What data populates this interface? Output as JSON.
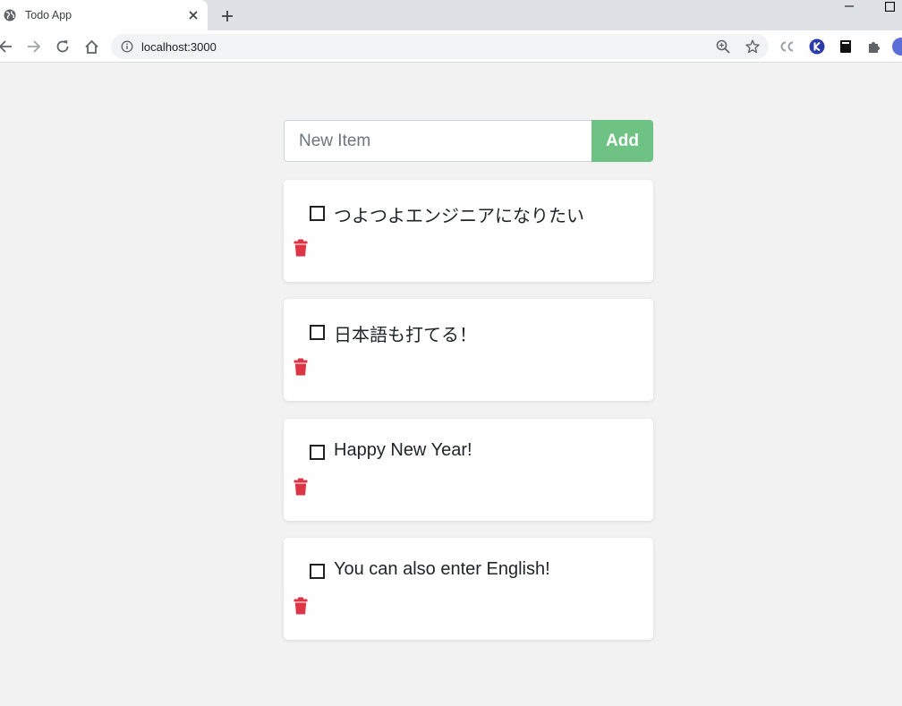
{
  "browser": {
    "tab_title": "Todo App",
    "url": "localhost:3000"
  },
  "app": {
    "input_placeholder": "New Item",
    "add_label": "Add",
    "accent_color": "#6ec283",
    "delete_color": "#dc3545",
    "items": [
      {
        "text": "つよつよエンジニアになりたい",
        "completed": false
      },
      {
        "text": "日本語も打てる！",
        "completed": false
      },
      {
        "text": "Happy New Year!",
        "completed": false
      },
      {
        "text": "You can also enter English!",
        "completed": false
      }
    ]
  }
}
